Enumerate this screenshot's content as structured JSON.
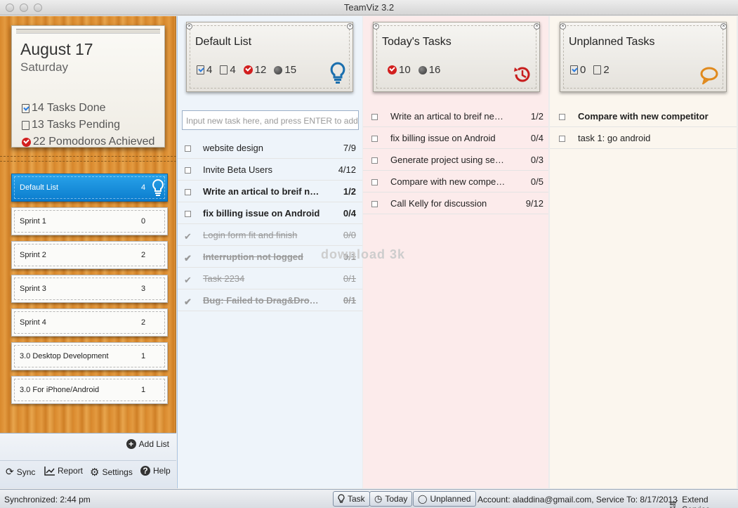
{
  "window": {
    "title": "TeamViz 3.2"
  },
  "sidebar": {
    "date": "August 17",
    "day": "Saturday",
    "stats": {
      "done": "14 Tasks Done",
      "pending": "13 Tasks Pending",
      "pomodoros": "22 Pomodoros Achieved"
    },
    "lists": [
      {
        "name": "Default List",
        "count": "4"
      },
      {
        "name": "Sprint 1",
        "count": "0"
      },
      {
        "name": "Sprint 2",
        "count": "2"
      },
      {
        "name": "Sprint 3",
        "count": "3"
      },
      {
        "name": "Sprint 4",
        "count": "2"
      },
      {
        "name": "3.0 Desktop Development",
        "count": "1"
      },
      {
        "name": "3.0 For iPhone/Android",
        "count": "1"
      }
    ],
    "add_list": "Add List",
    "tools": {
      "sync": "Sync",
      "report": "Report",
      "settings": "Settings",
      "help": "Help"
    }
  },
  "columns": {
    "default": {
      "title": "Default List",
      "stats": {
        "done": "4",
        "pending": "4",
        "pomodoros": "12",
        "interruptions": "15"
      },
      "input_placeholder": "Input new task here, and press ENTER to add",
      "tasks": [
        {
          "name": "website design",
          "progress": "7/9"
        },
        {
          "name": "Invite Beta Users",
          "progress": "4/12"
        },
        {
          "name": "Write an artical to breif new features",
          "progress": "1/2"
        },
        {
          "name": "fix billing issue on Android",
          "progress": "0/4"
        },
        {
          "name": "Login form fit and finish",
          "progress": "0/0"
        },
        {
          "name": "Interruption not logged",
          "progress": "0/1"
        },
        {
          "name": "Task 2234",
          "progress": "0/1"
        },
        {
          "name": "Bug: Failed to Drag&Drop task",
          "progress": "0/1"
        }
      ]
    },
    "today": {
      "title": "Today's Tasks",
      "stats": {
        "pomodoros": "10",
        "interruptions": "16"
      },
      "tasks": [
        {
          "name": "Write an artical to breif new features",
          "progress": "1/2"
        },
        {
          "name": "fix billing issue on Android",
          "progress": "0/4"
        },
        {
          "name": "Generate project using sencha",
          "progress": "0/3"
        },
        {
          "name": "Compare with new competitor",
          "progress": "0/5"
        },
        {
          "name": "Call Kelly for discussion",
          "progress": "9/12"
        }
      ]
    },
    "unplanned": {
      "title": "Unplanned Tasks",
      "stats": {
        "done": "0",
        "pending": "2"
      },
      "tasks": [
        {
          "name": "Compare with new competitor"
        },
        {
          "name": "task 1: go android"
        }
      ]
    }
  },
  "watermark": "download 3k",
  "statusbar": {
    "sync": "Synchronized: 2:44 pm",
    "buttons": {
      "task": "Task",
      "today": "Today",
      "unplanned": "Unplanned"
    },
    "account": "Account: aladdina@gmail.com, Service To: 8/17/2013",
    "extend": "Extend Service"
  }
}
